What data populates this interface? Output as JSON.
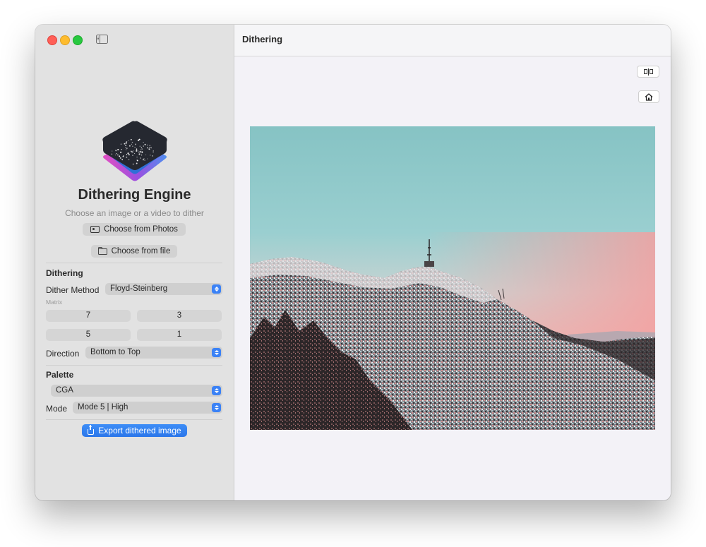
{
  "window": {
    "title": "Dithering"
  },
  "sidebar": {
    "app_name": "Dithering Engine",
    "subtitle": "Choose an image or a video to dither",
    "choose_photos": "Choose from Photos",
    "choose_file": "Choose from file",
    "dithering": {
      "section_title": "Dithering",
      "method_label": "Dither Method",
      "method_value": "Floyd-Steinberg",
      "matrix_label": "Matrix",
      "matrix": [
        "7",
        "3",
        "5",
        "1"
      ],
      "direction_label": "Direction",
      "direction_value": "Bottom to Top"
    },
    "palette": {
      "section_title": "Palette",
      "palette_value": "CGA",
      "mode_label": "Mode",
      "mode_value": "Mode 5 | High"
    },
    "export_label": "Export dithered image"
  },
  "toolbar": {
    "compare_icon": "split-view-icon",
    "home_icon": "home-icon"
  },
  "colors": {
    "accent": "#3b82f6",
    "sidebar_bg": "#e2e2e2",
    "content_bg": "#f3f2f7",
    "sky": "#8fc9c9",
    "haze_pink": "#f0a8a8"
  }
}
